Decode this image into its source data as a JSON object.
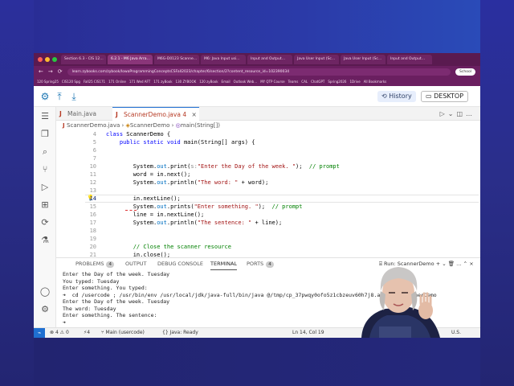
{
  "browser": {
    "tabs": [
      "Section 6.3 - CIS 12…",
      "6.2.1 - M6 Java Arra…",
      "M6G-D0123 Scanne…",
      "M6: Java Input usi…",
      "Input and Output…",
      "Java User Input (Sc…",
      "Java User Input (Sc…",
      "Input and Output…"
    ],
    "active_tab": 1,
    "url": "learn.zybooks.com/zybook/IowaProgrammingConceptsCSFall2023/chapter/6/section/2?content_resource_id=102390034",
    "school_label": "School",
    "bookmarks": [
      "120 Spring25",
      "CIS120 Spg",
      "Fall25 CIS171",
      "171 Online",
      "171 Wed AFT",
      "171 zyBook",
      "130 ZYBOOK",
      "120 zyBook",
      "Email",
      "Outlook Web…",
      "MY QTP Course",
      "Teams",
      "CAL",
      "ChatGPT",
      "Spring2026",
      "1Drive",
      "All Bookmarks"
    ]
  },
  "toolbar": {
    "history_label": "History",
    "desktop_label": "DESKTOP"
  },
  "editor": {
    "tabs": [
      {
        "label": "Main.java",
        "active": false
      },
      {
        "label": "ScannerDemo.java 4",
        "active": true
      }
    ],
    "breadcrumb": {
      "file": "ScannerDemo.java",
      "class": "ScannerDemo",
      "method": "main(String[])"
    },
    "current_line": 14,
    "lines": [
      {
        "n": 4,
        "html_parts": [
          [
            "kw",
            "class "
          ],
          [
            "",
            "ScannerDemo {"
          ]
        ]
      },
      {
        "n": 5,
        "html_parts": [
          [
            "",
            "    "
          ],
          [
            "kw",
            "public static void "
          ],
          [
            "",
            "main(String[] args) {"
          ]
        ]
      },
      {
        "n": 6,
        "html_parts": [
          [
            "",
            ""
          ]
        ]
      },
      {
        "n": 7,
        "html_parts": [
          [
            "",
            ""
          ]
        ]
      },
      {
        "n": 10,
        "html_parts": [
          [
            "",
            "        System."
          ],
          [
            "field",
            "out"
          ],
          [
            "",
            ".print("
          ],
          [
            "hint",
            "s:"
          ],
          [
            "str",
            "\"Enter the Day of the week. \""
          ],
          [
            "",
            ");  "
          ],
          [
            "cm",
            "// prompt"
          ]
        ]
      },
      {
        "n": 11,
        "html_parts": [
          [
            "",
            "        word = in.next();"
          ]
        ]
      },
      {
        "n": 12,
        "html_parts": [
          [
            "",
            "        System."
          ],
          [
            "field",
            "out"
          ],
          [
            "",
            ".println("
          ],
          [
            "str",
            "\"The word: \""
          ],
          [
            "",
            " + word);"
          ]
        ]
      },
      {
        "n": 13,
        "html_parts": [
          [
            "",
            ""
          ]
        ]
      },
      {
        "n": 14,
        "html_parts": [
          [
            "",
            "        in.nextLine();"
          ]
        ]
      },
      {
        "n": 15,
        "html_parts": [
          [
            "",
            "        System."
          ],
          [
            "field",
            "out"
          ],
          [
            "",
            ".prints("
          ],
          [
            "str",
            "\"Enter something. \""
          ],
          [
            "",
            ");  "
          ],
          [
            "cm",
            "// prompt"
          ]
        ]
      },
      {
        "n": 16,
        "html_parts": [
          [
            "",
            "        line = in.nextLine();"
          ]
        ]
      },
      {
        "n": 17,
        "html_parts": [
          [
            "",
            "        System."
          ],
          [
            "field",
            "out"
          ],
          [
            "",
            ".println("
          ],
          [
            "str",
            "\"The sentence: \""
          ],
          [
            "",
            " + line);"
          ]
        ]
      },
      {
        "n": 18,
        "html_parts": [
          [
            "",
            ""
          ]
        ]
      },
      {
        "n": 19,
        "html_parts": [
          [
            "",
            ""
          ]
        ]
      },
      {
        "n": 20,
        "html_parts": [
          [
            "",
            "        "
          ],
          [
            "cm",
            "// Close the scanner resource"
          ]
        ]
      },
      {
        "n": 21,
        "html_parts": [
          [
            "",
            "        in.close();"
          ]
        ]
      }
    ]
  },
  "panel": {
    "tabs": [
      {
        "label": "PROBLEMS",
        "badge": "4"
      },
      {
        "label": "OUTPUT",
        "badge": ""
      },
      {
        "label": "DEBUG CONSOLE",
        "badge": ""
      },
      {
        "label": "TERMINAL",
        "badge": "",
        "active": true
      },
      {
        "label": "PORTS",
        "badge": "4"
      }
    ],
    "run_label": "Run: ScannerDemo",
    "terminal_lines": [
      "Enter the Day of the week. Tuesday",
      "You typed: Tuesday",
      "Enter something. You typed:",
      "➜  cd /usercode ; /usr/bin/env /usr/local/jdk/java-full/bin/java @/tmp/cp_37pwqy0ofo5z1cbzeuv60h7j8.argfile ScannerDemo",
      "Enter the Day of the week. Tuesday",
      "The word: Tuesday",
      "Enter something. The sentence:",
      "➜ "
    ]
  },
  "status": {
    "errors": "4",
    "warnings": "0",
    "ports": "4",
    "branch": "Main (usercode)",
    "java": "Java: Ready",
    "position": "Ln 14, Col 19",
    "lang": "U.S."
  }
}
